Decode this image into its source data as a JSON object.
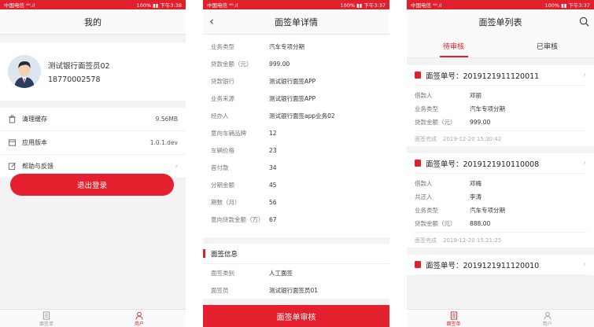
{
  "status": {
    "s1_left": "中国电信 ⁴ᴳ.ıl",
    "s1_right": "100% ▮▮ 下午3:38",
    "s2_left": "中国电信 ⁴ᴳ.ıl",
    "s2_right": "100% ▮▮ 下午3:37",
    "s3_left": "中国电信 ⁴ᴳ.ıl",
    "s3_right": "100% ▮▮ 下午3:37"
  },
  "profile_screen": {
    "title": "我的",
    "name": "测试银行面签员02",
    "phone": "18770002578",
    "menu": [
      {
        "label": "清理缓存",
        "value": "9.56MB",
        "icon": "trash-icon"
      },
      {
        "label": "应用版本",
        "value": "1.0.1.dev",
        "icon": "app-version-icon"
      },
      {
        "label": "帮助与反馈",
        "value": "›",
        "icon": "edit-feedback-icon"
      }
    ],
    "logout": "退出登录",
    "tabs": [
      {
        "label": "面签单",
        "icon": "document-icon",
        "active": false
      },
      {
        "label": "用户",
        "icon": "user-icon",
        "active": true
      }
    ]
  },
  "detail_screen": {
    "title": "面签单详情",
    "rows": [
      {
        "k": "业务类型",
        "v": "汽车专项分期"
      },
      {
        "k": "贷款金额（元）",
        "v": "999.00"
      },
      {
        "k": "贷款银行",
        "v": "测试银行面签APP"
      },
      {
        "k": "业务来源",
        "v": "测试银行面签APP"
      },
      {
        "k": "经办人",
        "v": "测试银行面签app业务02"
      },
      {
        "k": "意向车辆品牌",
        "v": "12"
      },
      {
        "k": "车辆价格",
        "v": "23"
      },
      {
        "k": "首付款",
        "v": "34"
      },
      {
        "k": "分期金额",
        "v": "45"
      },
      {
        "k": "期数（月）",
        "v": "56"
      },
      {
        "k": "意向贷款金额（万）",
        "v": "67"
      }
    ],
    "section_title": "面签信息",
    "section_rows": [
      {
        "k": "面签类别",
        "v": "人工面签"
      },
      {
        "k": "面签员",
        "v": "测试银行面签员01"
      }
    ],
    "bottom_button": "面签单审核"
  },
  "list_screen": {
    "title": "面签单列表",
    "tabs": [
      {
        "label": "待审核",
        "active": true
      },
      {
        "label": "已审核",
        "active": false
      }
    ],
    "cards": [
      {
        "title": "面签单号：2019121911120011",
        "rows": [
          {
            "k": "借款人",
            "v": "邓丽"
          },
          {
            "k": "业务类型",
            "v": "汽车专项分期"
          },
          {
            "k": "贷款金额（元）",
            "v": "999.00"
          }
        ],
        "status": "面签完成",
        "time": "2019-12-20 15:30:42"
      },
      {
        "title": "面签单号：2019121910110008",
        "rows": [
          {
            "k": "借款人",
            "v": "邓梅"
          },
          {
            "k": "共还人",
            "v": "李涛"
          },
          {
            "k": "业务类型",
            "v": "汽车专项分期"
          },
          {
            "k": "贷款金额（元）",
            "v": "888.00"
          }
        ],
        "status": "面签完成",
        "time": "2019-12-20 15:21:25"
      },
      {
        "title": "面签单号：2019121911120010",
        "rows": [],
        "status": "",
        "time": ""
      }
    ],
    "bottom_tabs": [
      {
        "label": "面签单",
        "icon": "document-icon",
        "active": true
      },
      {
        "label": "用户",
        "icon": "user-icon",
        "active": false
      }
    ]
  },
  "colors": {
    "accent": "#e0202c",
    "background": "#f3f3f3"
  }
}
